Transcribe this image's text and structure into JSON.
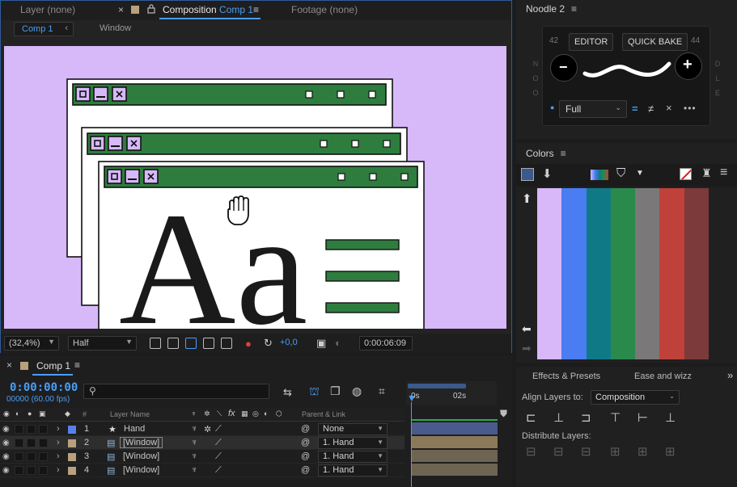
{
  "viewer": {
    "tabs": [
      {
        "label": "Layer",
        "detail": "(none)"
      },
      {
        "label": "Composition",
        "detail": "Comp 1"
      },
      {
        "label": "Footage",
        "detail": "(none)"
      }
    ],
    "breadcrumb": {
      "active": "Comp 1",
      "next": "Window"
    },
    "footer": {
      "zoom": "(32,4%)",
      "resolution": "Half",
      "exposure": "+0,0",
      "timecode": "0:00:06:09"
    }
  },
  "noodle": {
    "title": "Noodle 2",
    "left_number": "42",
    "right_number": "44",
    "editor_label": "EDITOR",
    "quick_bake_label": "QUICK BAKE",
    "left_letters": [
      "N",
      "O",
      "O"
    ],
    "right_letters": [
      "D",
      "L",
      "E"
    ],
    "mode_select": "Full",
    "minus_symbol": "−",
    "plus_symbol": "+",
    "more_symbol": "•••"
  },
  "colors_panel": {
    "title": "Colors",
    "swatches": [
      "#d8b8f9",
      "#4a7cf2",
      "#0f7a86",
      "#2a8a4c",
      "#7a7878",
      "#c0403a",
      "#7d3a3a"
    ]
  },
  "timeline": {
    "title": "Comp 1",
    "timecode": "0:00:00:00",
    "frame_info": "00000 (60.00 fps)",
    "columns": {
      "number": "#",
      "layer_name": "Layer Name",
      "parent": "Parent & Link"
    },
    "ruler_labels": [
      "0s",
      "02s"
    ],
    "layers": [
      {
        "index": "1",
        "name": "Hand",
        "parent": "None",
        "label_color": "#5a7fea"
      },
      {
        "index": "2",
        "name": "[Window]",
        "parent": "1. Hand",
        "label_color": "#b9a07e"
      },
      {
        "index": "3",
        "name": "[Window]",
        "parent": "1. Hand",
        "label_color": "#b9a07e"
      },
      {
        "index": "4",
        "name": "[Window]",
        "parent": "1. Hand",
        "label_color": "#b9a07e"
      }
    ]
  },
  "right_bottom": {
    "tab_effects": "Effects & Presets",
    "tab_ease": "Ease and wizz",
    "align_label": "Align Layers to:",
    "align_target": "Composition",
    "distribute_label": "Distribute Layers:"
  },
  "artwork": {
    "big_text": "Aa",
    "window_buttons": [
      "▢",
      "—",
      "×"
    ],
    "bg_color": "#d7b8f9",
    "bar_color": "#2e7d3e"
  }
}
